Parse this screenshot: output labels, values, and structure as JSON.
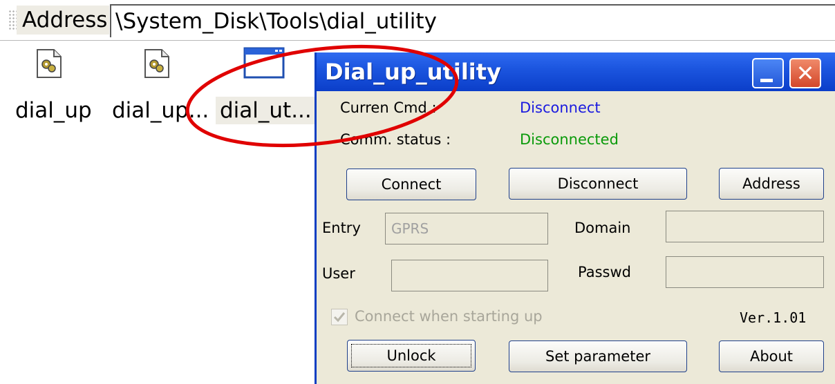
{
  "address_bar": {
    "label": "Address",
    "path": "\\System_Disk\\Tools\\dial_utility"
  },
  "files": [
    {
      "label": "dial_up",
      "icon": "config-file-icon"
    },
    {
      "label": "dial_up...",
      "icon": "config-file-icon"
    },
    {
      "label": "dial_ut...",
      "icon": "application-window-icon",
      "selected": true
    }
  ],
  "dialog": {
    "title": "Dial_up_utility",
    "current_cmd_label": "Curren Cmd :",
    "current_cmd_value": "Disconnect",
    "comm_status_label": "Comm. status :",
    "comm_status_value": "Disconnected",
    "buttons": {
      "connect": "Connect",
      "disconnect": "Disconnect",
      "address": "Address",
      "unlock": "Unlock",
      "set_parameter": "Set parameter",
      "about": "About"
    },
    "fields": {
      "entry_label": "Entry",
      "entry_value": "GPRS",
      "domain_label": "Domain",
      "domain_value": "",
      "user_label": "User",
      "user_value": "",
      "passwd_label": "Passwd",
      "passwd_value": ""
    },
    "checkbox": {
      "label": "Connect when starting up",
      "checked": true
    },
    "version": "Ver.1.01"
  },
  "colors": {
    "cmd_value": "#1a1adf",
    "status_value": "#0a9a0a",
    "annotation_ellipse": "#e00000",
    "titlebar": "#1c56e0"
  }
}
